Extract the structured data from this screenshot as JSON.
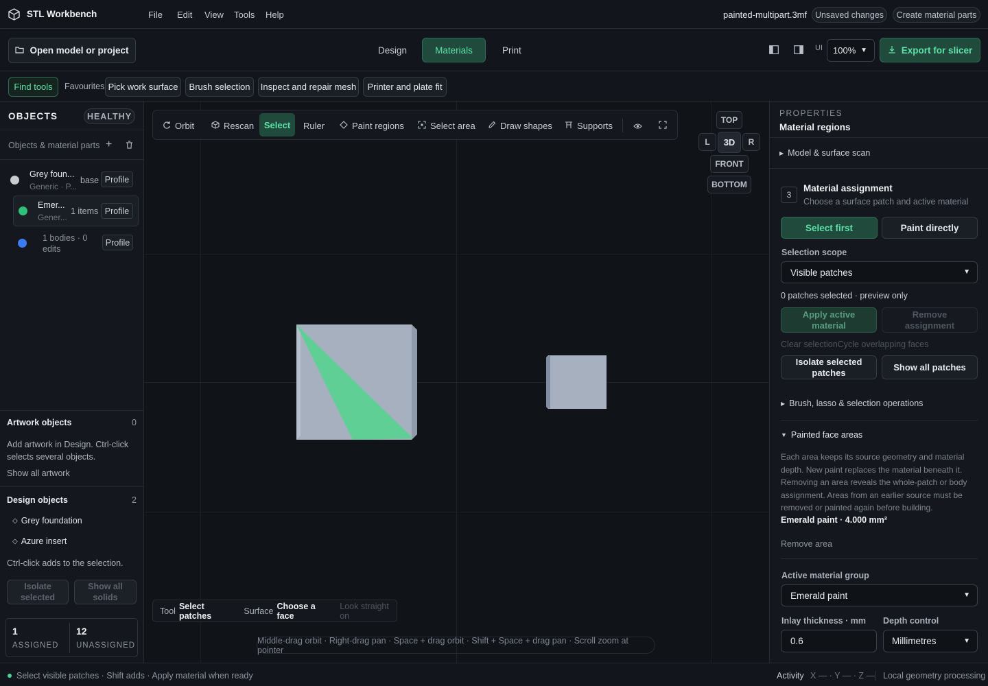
{
  "app": {
    "title": "STL Workbench",
    "file_name": "painted-multipart.3mf",
    "unsaved_label": "Unsaved changes",
    "create_parts_label": "Create material parts"
  },
  "menu": [
    "File",
    "Edit",
    "View",
    "Tools",
    "Help"
  ],
  "toolbar": {
    "open_label": "Open model or project",
    "tabs": [
      "Design",
      "Materials",
      "Print"
    ],
    "active_tab": "Materials",
    "ui_label": "UI",
    "zoom_value": "100%",
    "export_label": "Export for slicer"
  },
  "tool_strip": {
    "find_tools": "Find tools",
    "favourites": "Favourites",
    "items": [
      "Pick work surface",
      "Brush selection",
      "Inspect and repair mesh",
      "Printer and plate fit"
    ]
  },
  "objects_panel": {
    "title": "OBJECTS",
    "health_badge": "HEALTHY",
    "subheader": "Objects & material parts",
    "rows": [
      {
        "name": "Grey foun...",
        "sub": "Generic · P...",
        "meta": "base",
        "action": "Profile",
        "color": "#c9cbcf"
      },
      {
        "name": "Emer...",
        "sub": "Gener...",
        "meta": "1 items",
        "action": "Profile",
        "color": "#2fc07a"
      },
      {
        "name": "",
        "sub": "",
        "meta": "1 bodies · 0 edits",
        "action": "Profile",
        "color": "#3b7cf2"
      }
    ],
    "artwork_title": "Artwork objects",
    "artwork_count": "0",
    "artwork_help": "Add artwork in Design. Ctrl-click selects several objects.",
    "show_all_artwork": "Show all artwork",
    "design_title": "Design objects",
    "design_count": "2",
    "design_items": [
      "Grey foundation",
      "Azure insert"
    ],
    "ctrl_help": "Ctrl-click adds to the selection.",
    "isolate_label": "Isolate selected",
    "show_all_solids": "Show all solids",
    "assigned_count": "1",
    "assigned_label": "ASSIGNED",
    "unassigned_count": "12",
    "unassigned_label": "UNASSIGNED"
  },
  "viewport": {
    "tools": [
      "Orbit",
      "Rescan",
      "Select",
      "Ruler",
      "Paint regions",
      "Select area",
      "Draw shapes",
      "Supports"
    ],
    "active_tool": "Select",
    "view_buttons": {
      "top": "TOP",
      "left": "L",
      "center": "3D",
      "right": "R",
      "front": "FRONT",
      "bottom": "BOTTOM"
    },
    "status_tool_label": "Tool",
    "status_tool_value": "Select patches",
    "status_surface_label": "Surface",
    "status_surface_value": "Choose a face",
    "status_hint": "Look straight on",
    "controls_hint": "Middle-drag orbit · Right-drag pan · Space + drag orbit · Shift + Space + drag pan · Scroll zoom at pointer",
    "colors": {
      "model_grey": "#a6b0bf",
      "paint_green": "#5fcf96"
    }
  },
  "properties": {
    "section_label": "PROPERTIES",
    "title": "Material regions",
    "model_scan": "Model & surface scan",
    "step_number": "3",
    "step_title": "Material assignment",
    "step_sub": "Choose a surface patch and active material",
    "select_first": "Select first",
    "paint_directly": "Paint directly",
    "scope_label": "Selection scope",
    "scope_value": "Visible patches",
    "patches_status": "0 patches selected · preview only",
    "apply_label": "Apply active material",
    "remove_label": "Remove assignment",
    "clear_cycle": "Clear selectionCycle overlapping faces",
    "isolate_patches": "Isolate selected patches",
    "show_patches": "Show all patches",
    "brush_ops": "Brush, lasso & selection operations",
    "painted_title": "Painted face areas",
    "painted_help": "Each area keeps its source geometry and material depth. New paint replaces the material beneath it. Removing an area reveals the whole-patch or body assignment. Areas from an earlier source must be removed or painted again before building.",
    "painted_entry": "Emerald paint · 4.000 mm²",
    "remove_area": "Remove area",
    "group_label": "Active material group",
    "group_value": "Emerald paint",
    "inlay_label": "Inlay thickness · mm",
    "inlay_value": "0.6",
    "depth_label": "Depth control",
    "depth_value": "Millimetres"
  },
  "statusbar": {
    "left": "Select visible patches · Shift adds · Apply material when ready",
    "activity": "Activity",
    "coords": "X — · Y — · Z —",
    "processing": "Local geometry processing"
  },
  "theme": {
    "accent": "#4ad59b",
    "accent_bg": "#1f4a3c",
    "background": "#12151b"
  }
}
